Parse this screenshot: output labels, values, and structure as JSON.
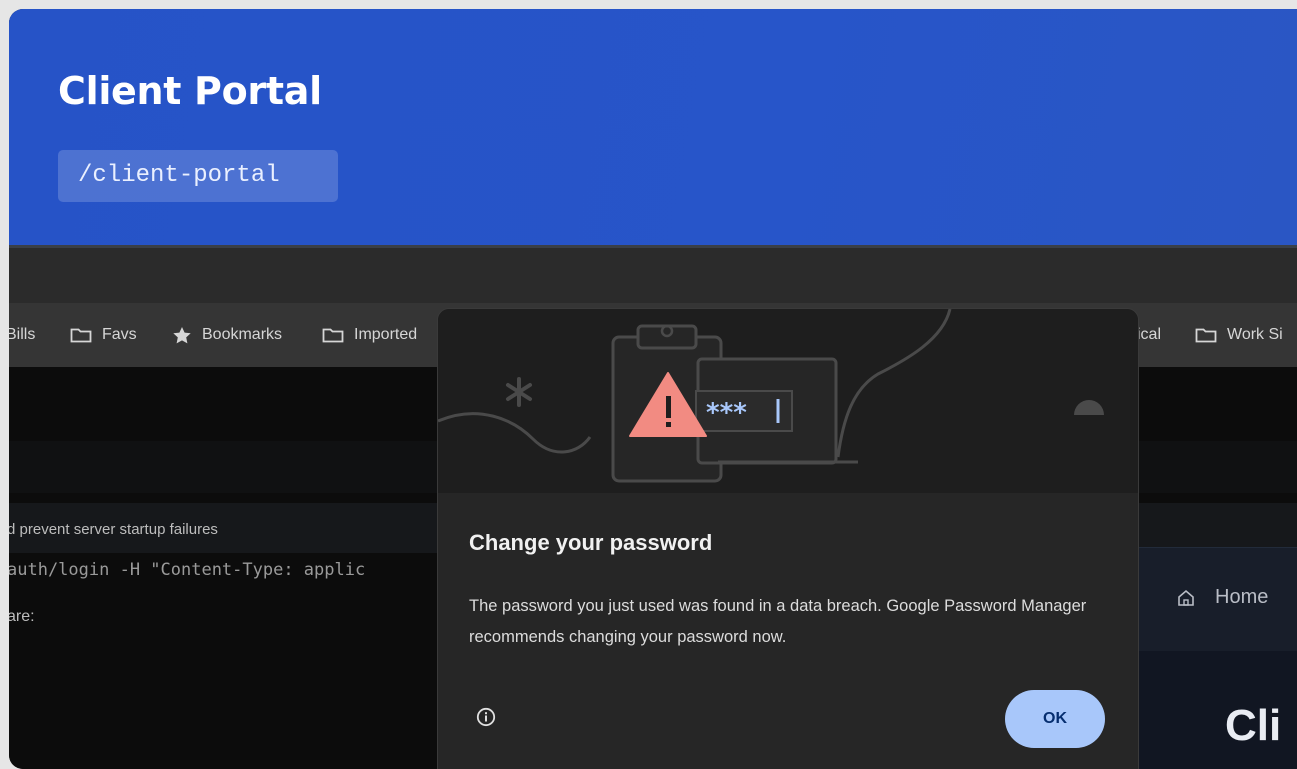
{
  "header": {
    "title": "Client Portal",
    "route": "/client-portal"
  },
  "bookmarks": [
    {
      "label": "Bills",
      "icon": "folder-icon"
    },
    {
      "label": "Favs",
      "icon": "folder-icon"
    },
    {
      "label": "Bookmarks",
      "icon": "star-icon"
    },
    {
      "label": "Imported",
      "icon": "folder-icon"
    },
    {
      "label": "ical",
      "icon": "folder-icon"
    },
    {
      "label": "Work Si",
      "icon": "folder-icon"
    }
  ],
  "background": {
    "notice": "d prevent server startup failures",
    "command": "auth/login -H \"Content-Type: applic",
    "snippet": " are:",
    "nav_home": "Home",
    "heading_fragment": "Cli"
  },
  "dialog": {
    "title": "Change your password",
    "body": "The password you just used was found in a data breach. Google Password Manager recommends changing your password now.",
    "ok_label": "OK",
    "masked_password": "***"
  },
  "colors": {
    "header": "#2653c7",
    "ok_button": "#a8c7fa",
    "warning": "#f28b82"
  }
}
